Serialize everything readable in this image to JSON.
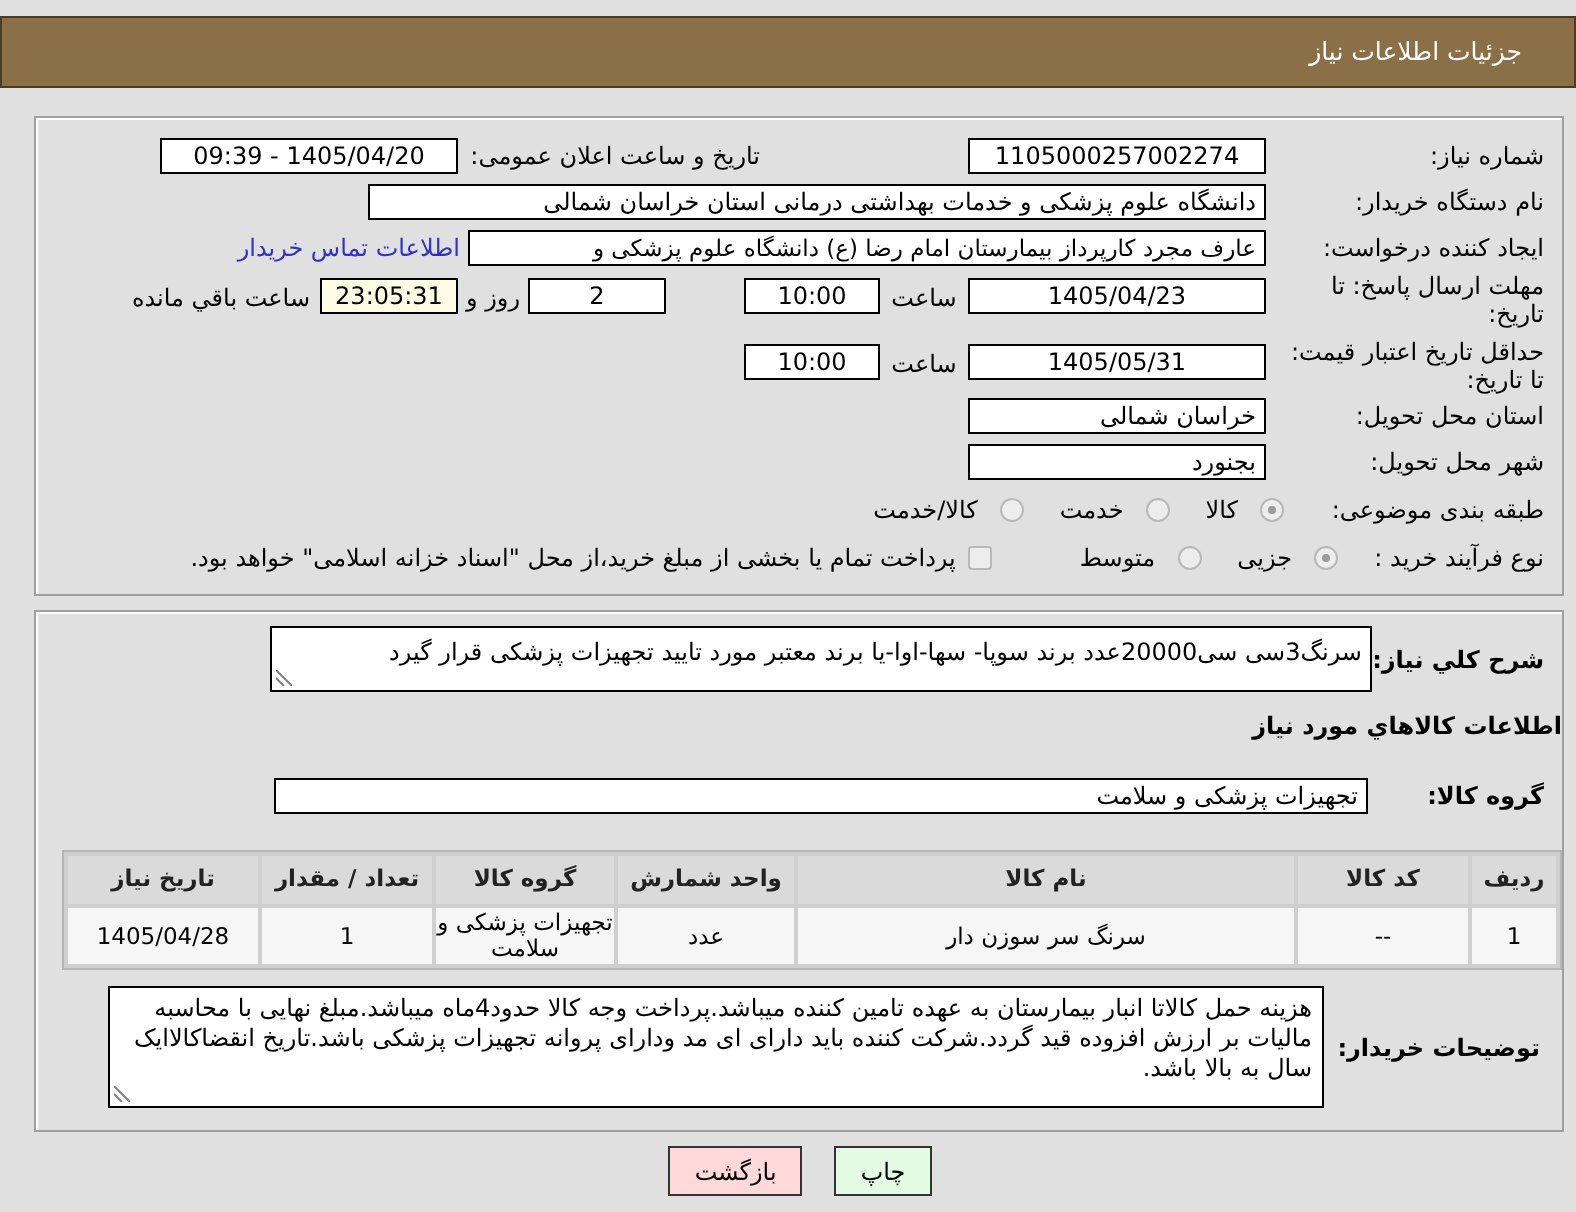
{
  "header": {
    "title": "جزئیات اطلاعات نیاز"
  },
  "details": {
    "need_number": {
      "label": "شماره نیاز:",
      "value": "1105000257002274"
    },
    "announcement": {
      "label": "تاریخ و ساعت اعلان عمومی:",
      "value": "1405/04/20 - 09:39"
    },
    "buyer_org": {
      "label": "نام دستگاه خریدار:",
      "value": "دانشگاه علوم پزشکی و خدمات بهداشتی درمانی استان خراسان شمالی"
    },
    "requester": {
      "label": "ایجاد کننده درخواست:",
      "value": "عارف مجرد کارپرداز بیمارستان امام رضا (ع) دانشگاه علوم پزشکی و",
      "link": "اطلاعات تماس خریدار"
    },
    "reply_deadline": {
      "label": "مهلت ارسال پاسخ: تا تاریخ:",
      "date": "1405/04/23",
      "time_label": "ساعت",
      "time": "10:00",
      "days": "2",
      "days_label": "روز و",
      "remaining": "23:05:31",
      "remaining_label": "ساعت باقي مانده"
    },
    "price_validity": {
      "label": "حداقل تاریخ اعتبار قیمت: تا تاریخ:",
      "date": "1405/05/31",
      "time_label": "ساعت",
      "time": "10:00"
    },
    "province": {
      "label": "استان محل تحویل:",
      "value": "خراسان شمالی"
    },
    "city": {
      "label": "شهر محل تحویل:",
      "value": "بجنورد"
    },
    "category": {
      "label": "طبقه بندی موضوعی:",
      "options": [
        {
          "label": "کالا",
          "selected": true
        },
        {
          "label": "خدمت",
          "selected": false
        },
        {
          "label": "کالا/خدمت",
          "selected": false
        }
      ]
    },
    "purchase_process": {
      "label": "نوع فرآیند خرید :",
      "options": [
        {
          "label": "جزیی",
          "selected": true
        },
        {
          "label": "متوسط",
          "selected": false
        }
      ],
      "treasury_option": {
        "label": "پرداخت تمام یا بخشی از مبلغ خرید،از محل \"اسناد خزانه اسلامی\" خواهد بود.",
        "checked": false
      }
    }
  },
  "need": {
    "description_label": "شرح کلي نياز:",
    "description": "سرنگ3سی سی20000عدد برند سوپا- سها-اوا-یا برند معتبر مورد تایید تجهیزات پزشکی قرار گیرد",
    "goods_heading": "اطلاعات کالاهاي مورد نياز",
    "goods_group_label": "گروه کالا:",
    "goods_group": "تجهیزات پزشکی و سلامت",
    "table": {
      "columns": [
        "ردیف",
        "کد کالا",
        "نام کالا",
        "واحد شمارش",
        "گروه کالا",
        "تعداد / مقدار",
        "تاریخ نیاز"
      ],
      "rows": [
        [
          "1",
          "--",
          "سرنگ سر سوزن دار",
          "عدد",
          "تجهیزات پزشکی و سلامت",
          "1",
          "1405/04/28"
        ]
      ]
    },
    "buyer_notes_label": "توضیحات خریدار:",
    "buyer_notes": "هزینه حمل کالاتا انبار بیمارستان به عهده تامین کننده میباشد.پرداخت وجه کالا حدود4ماه میباشد.مبلغ نهایی با محاسبه مالیات بر ارزش افزوده قید گردد.شرکت کننده باید دارای ای مد ودارای پروانه تجهیزات پزشکی باشد.تاریخ انقضاکالاایک سال به بالا باشد."
  },
  "buttons": [
    {
      "label": "چاپ",
      "kind": "print"
    },
    {
      "label": "بازگشت",
      "kind": "back"
    }
  ]
}
